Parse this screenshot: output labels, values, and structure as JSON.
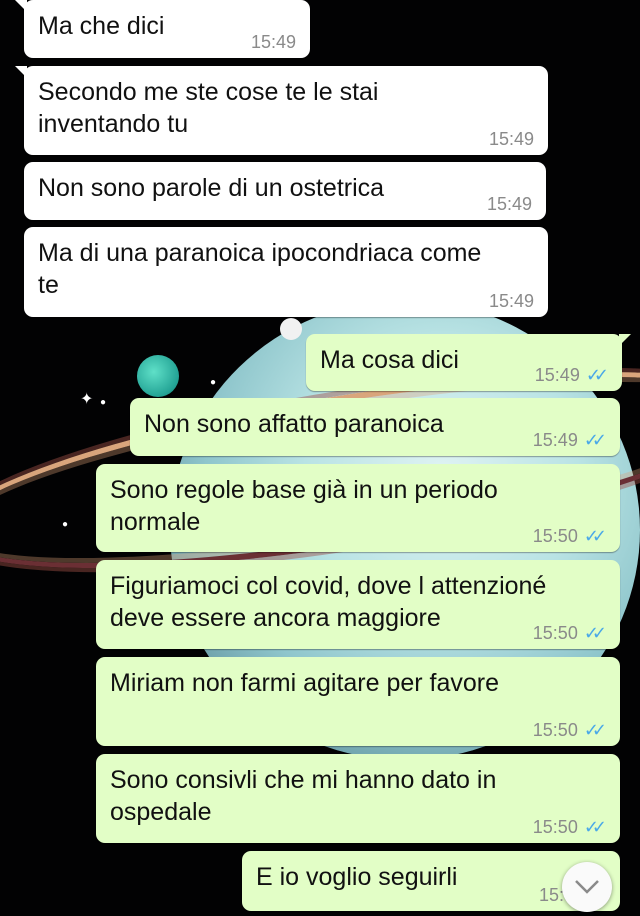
{
  "chat": {
    "messages": [
      {
        "direction": "incoming",
        "text": "Ma che dici",
        "time": "15:49"
      },
      {
        "direction": "incoming",
        "text": "Secondo me ste cose te le stai\ninventando tu",
        "time": "15:49"
      },
      {
        "direction": "incoming",
        "text": "Non sono parole di un ostetrica",
        "time": "15:49"
      },
      {
        "direction": "incoming",
        "text": "Ma di una paranoica ipocondriaca come\nte",
        "time": "15:49"
      },
      {
        "direction": "outgoing",
        "text": "Ma cosa dici",
        "time": "15:49",
        "status": "read"
      },
      {
        "direction": "outgoing",
        "text": "Non sono affatto paranoica",
        "time": "15:49",
        "status": "read"
      },
      {
        "direction": "outgoing",
        "text": "Sono regole base già in un periodo\nnormale",
        "time": "15:50",
        "status": "read"
      },
      {
        "direction": "outgoing",
        "text": "Figuriamoci col covid, dove l attenzioné\ndeve essere ancora maggiore",
        "time": "15:50",
        "status": "read"
      },
      {
        "direction": "outgoing",
        "text": "Miriam non farmi agitare per favore",
        "time": "15:50",
        "status": "read"
      },
      {
        "direction": "outgoing",
        "text": "Sono consivli che mi hanno dato in\nospedale",
        "time": "15:50",
        "status": "read"
      },
      {
        "direction": "outgoing",
        "text": "E io voglio seguirli",
        "time": "15:5",
        "status": "read"
      }
    ],
    "read_ticks": "✓✓",
    "scroll_down_icon": "chevron-down-icon"
  },
  "colors": {
    "incoming_bubble": "#ffffff",
    "outgoing_bubble": "#e2fec6",
    "read_tick": "#4aa8e8",
    "timestamp": "#8a8a8a"
  }
}
